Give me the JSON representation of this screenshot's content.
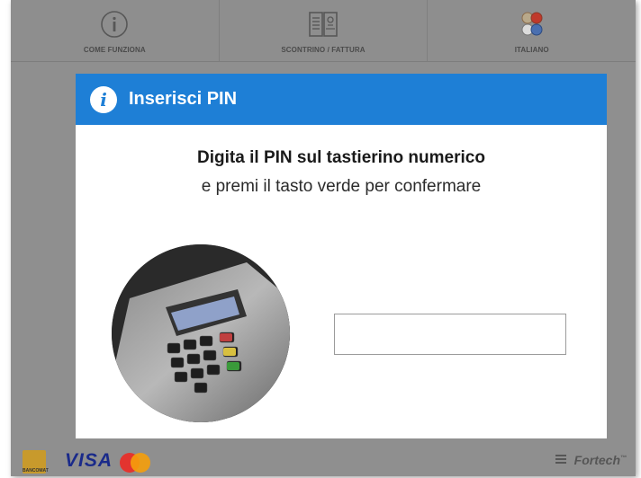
{
  "topbar": {
    "items": [
      {
        "label": "COME FUNZIONA",
        "icon": "info-icon"
      },
      {
        "label": "SCONTRINO / FATTURA",
        "icon": "receipt-icon"
      },
      {
        "label": "ITALIANO",
        "icon": "language-icon"
      }
    ]
  },
  "modal": {
    "title": "Inserisci PIN",
    "icon": "info-icon",
    "line1": "Digita il PIN sul tastierino numerico",
    "line2": "e premi il tasto verde per confermare",
    "pin_value": ""
  },
  "footer": {
    "pago_label": "BANCOMAT",
    "visa": "VISA",
    "brand": "Fortech",
    "brand_mark": "™"
  },
  "colors": {
    "header_blue": "#1e7fd6",
    "kiosk_grey": "#8f8f8f"
  }
}
